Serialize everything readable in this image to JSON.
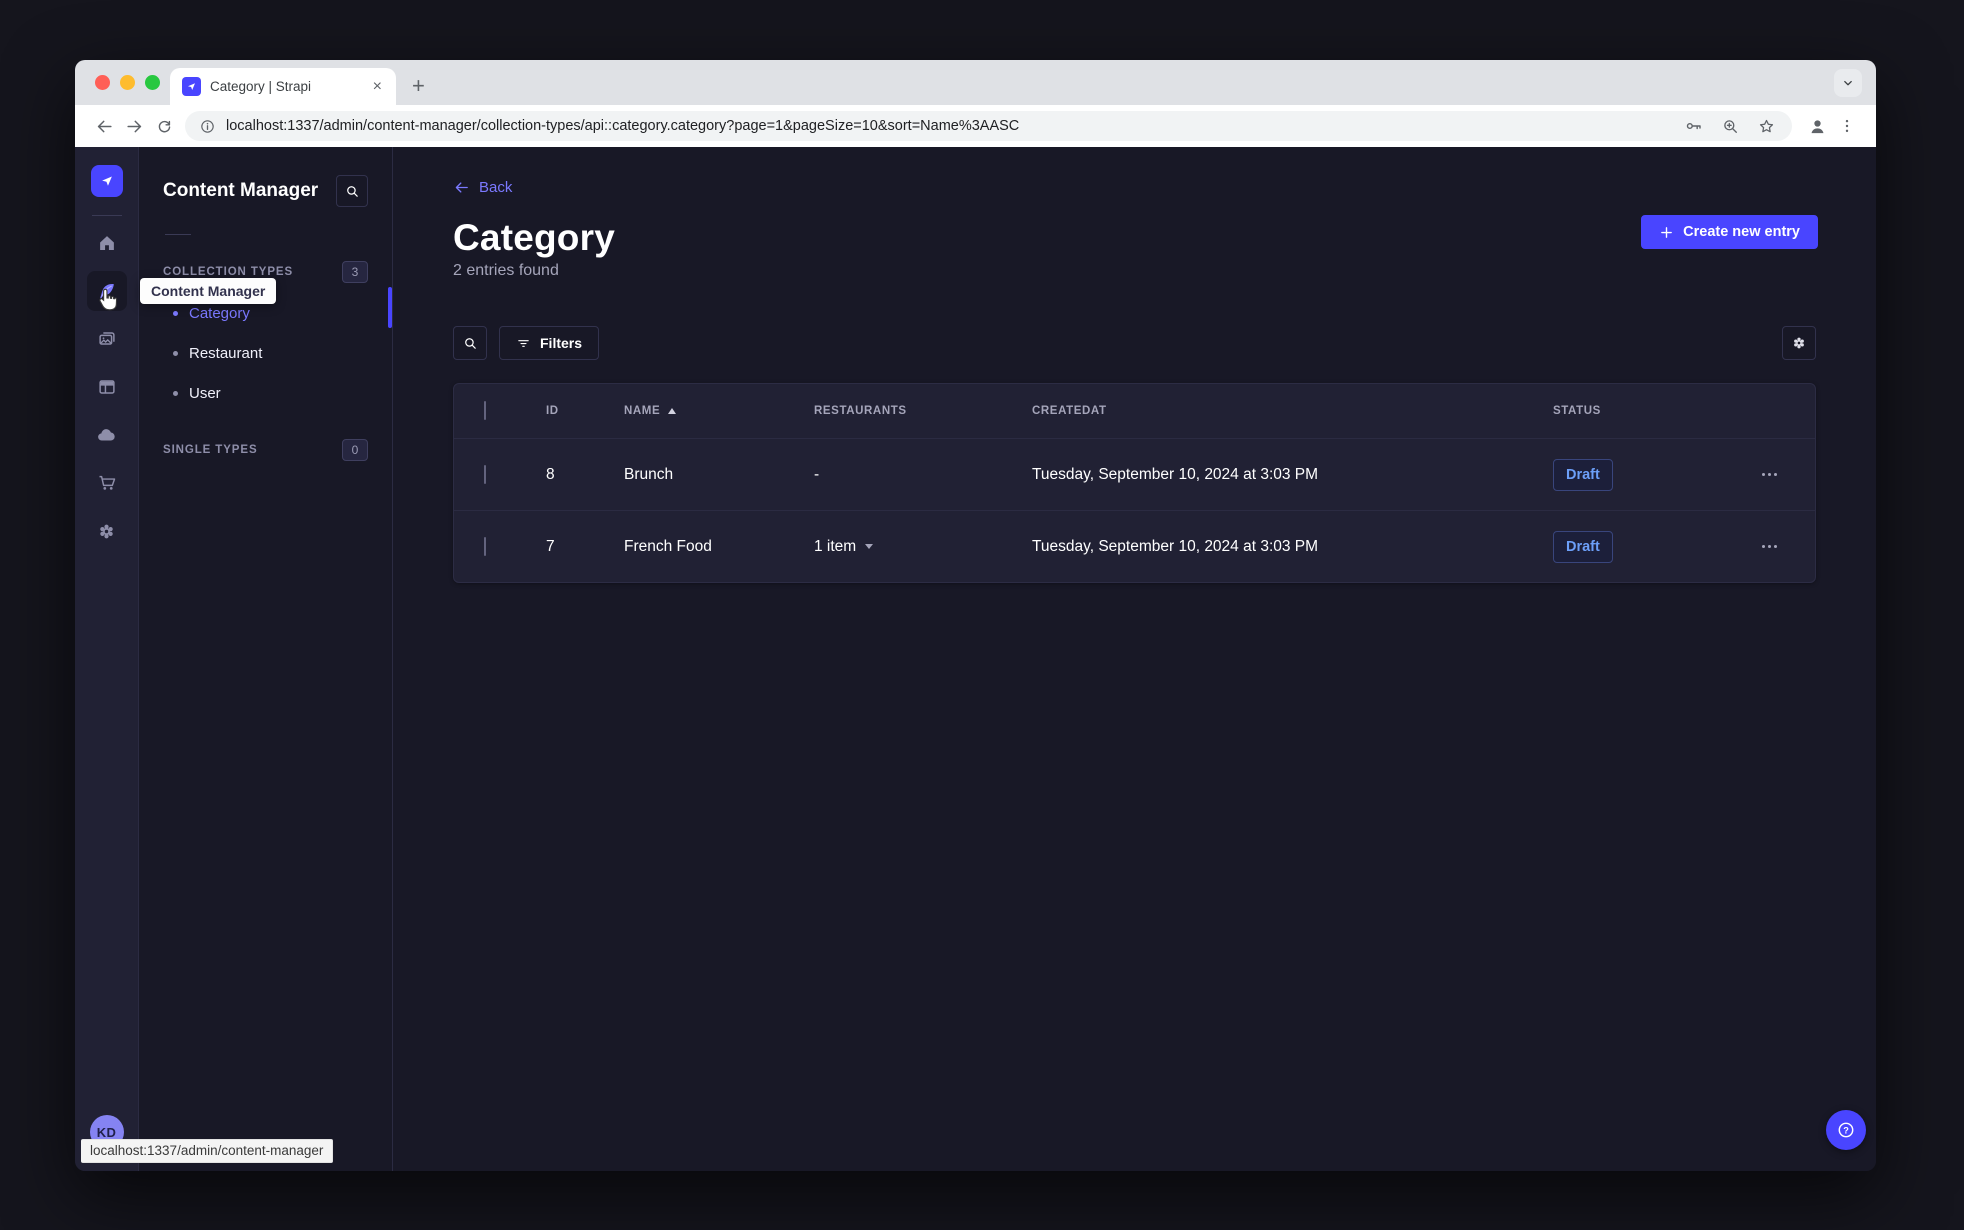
{
  "chrome": {
    "tab_title": "Category | Strapi",
    "new_tab_label": "+",
    "close_label": "×",
    "url": "localhost:1337/admin/content-manager/collection-types/api::category.category?page=1&pageSize=10&sort=Name%3AASC"
  },
  "sidebar": {
    "icons": [
      "strapi-logo",
      "home",
      "content-manager",
      "media-library",
      "content-type-builder",
      "cloud",
      "marketplace",
      "settings"
    ],
    "avatar_initials": "KD"
  },
  "subnav": {
    "title": "Content Manager",
    "collection_label": "COLLECTION TYPES",
    "collection_count": "3",
    "single_label": "SINGLE TYPES",
    "single_count": "0",
    "items": [
      {
        "label": "Category",
        "active": true
      },
      {
        "label": "Restaurant",
        "active": false
      },
      {
        "label": "User",
        "active": false
      }
    ]
  },
  "nav_tooltip": "Content Manager",
  "status_tooltip": "localhost:1337/admin/content-manager",
  "main": {
    "back": "Back",
    "title": "Category",
    "subtitle": "2 entries found",
    "create_button": "Create new entry",
    "filters_button": "Filters",
    "table": {
      "headers": {
        "id": "ID",
        "name": "NAME",
        "restaurants": "RESTAURANTS",
        "createdat": "CREATEDAT",
        "status": "STATUS"
      },
      "rows": [
        {
          "id": "8",
          "name": "Brunch",
          "restaurants": "-",
          "createdat": "Tuesday, September 10, 2024 at 3:03 PM",
          "status": "Draft"
        },
        {
          "id": "7",
          "name": "French Food",
          "restaurants": "1 item",
          "createdat": "Tuesday, September 10, 2024 at 3:03 PM",
          "status": "Draft"
        }
      ]
    }
  },
  "colors": {
    "accent": "#4945ff",
    "accent_light": "#7b79ff",
    "draft_text": "#6c9ff8"
  }
}
